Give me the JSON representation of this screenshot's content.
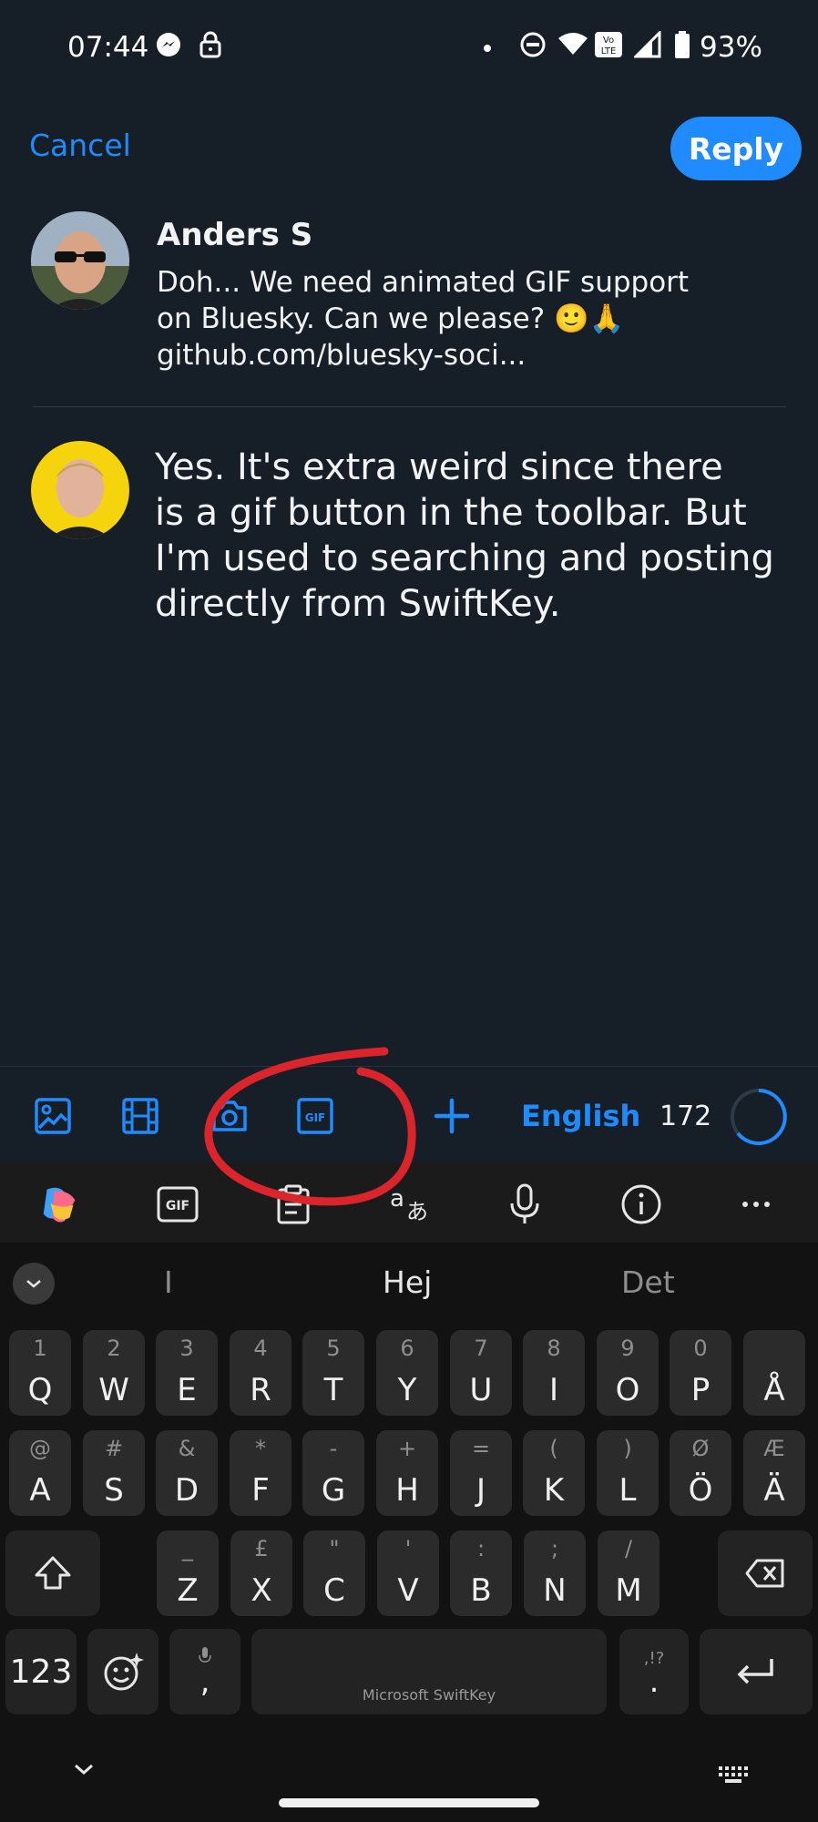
{
  "status_bar": {
    "time": "07:44",
    "battery": "93%",
    "icons": [
      "messenger-icon",
      "lock-icon",
      "dot-icon",
      "dnd-icon",
      "wifi-icon",
      "volte-icon",
      "signal-icon",
      "battery-icon"
    ]
  },
  "header": {
    "cancel_label": "Cancel",
    "reply_label": "Reply"
  },
  "quoted_post": {
    "author": "Anders S",
    "text_line1": "Doh... We need animated GIF support",
    "text_line2": "on Bluesky. Can we please? 🙂🙏",
    "text_line3": "github.com/bluesky-soci..."
  },
  "composer": {
    "line1": "Yes. It's extra weird since there",
    "line2": "is a gif button in the toolbar. But",
    "line3": "I'm used to searching and posting",
    "line4": "directly from SwiftKey."
  },
  "toolbar": {
    "language": "English",
    "char_count": "172",
    "gif_label": "GIF"
  },
  "keyboard": {
    "toolbar_gif_label": "GIF",
    "translate_label": "ā",
    "suggestions": [
      "I",
      "Hej",
      "Det"
    ],
    "row1": [
      {
        "hint": "1",
        "ch": "Q"
      },
      {
        "hint": "2",
        "ch": "W"
      },
      {
        "hint": "3",
        "ch": "E"
      },
      {
        "hint": "4",
        "ch": "R"
      },
      {
        "hint": "5",
        "ch": "T"
      },
      {
        "hint": "6",
        "ch": "Y"
      },
      {
        "hint": "7",
        "ch": "U"
      },
      {
        "hint": "8",
        "ch": "I"
      },
      {
        "hint": "9",
        "ch": "O"
      },
      {
        "hint": "0",
        "ch": "P"
      },
      {
        "hint": "",
        "ch": "Å"
      }
    ],
    "row2": [
      {
        "hint": "@",
        "ch": "A"
      },
      {
        "hint": "#",
        "ch": "S"
      },
      {
        "hint": "&",
        "ch": "D"
      },
      {
        "hint": "*",
        "ch": "F"
      },
      {
        "hint": "-",
        "ch": "G"
      },
      {
        "hint": "+",
        "ch": "H"
      },
      {
        "hint": "=",
        "ch": "J"
      },
      {
        "hint": "(",
        "ch": "K"
      },
      {
        "hint": ")",
        "ch": "L"
      },
      {
        "hint": "Ø",
        "ch": "Ö"
      },
      {
        "hint": "Æ",
        "ch": "Ä"
      }
    ],
    "row3": [
      {
        "hint": "_",
        "ch": "Z"
      },
      {
        "hint": "£",
        "ch": "X"
      },
      {
        "hint": "\"",
        "ch": "C"
      },
      {
        "hint": "'",
        "ch": "V"
      },
      {
        "hint": ":",
        "ch": "B"
      },
      {
        "hint": ";",
        "ch": "N"
      },
      {
        "hint": "/",
        "ch": "M"
      }
    ],
    "numbers_label": "123",
    "comma_label": ",",
    "period_label": ".",
    "period_hint": ",!?",
    "space_label": "Microsoft SwiftKey"
  },
  "colors": {
    "accent": "#208bfe",
    "background": "#161e27",
    "keyboard": "#121212",
    "annotation": "#d9252b"
  }
}
